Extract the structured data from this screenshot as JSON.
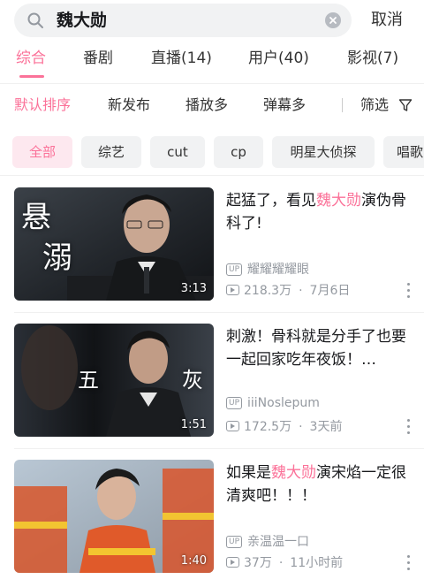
{
  "search": {
    "query": "魏大勋",
    "cancel_label": "取消"
  },
  "tabs": [
    {
      "label": "综合",
      "active": true
    },
    {
      "label": "番剧"
    },
    {
      "label": "直播(14)"
    },
    {
      "label": "用户(40)"
    },
    {
      "label": "影视(7)"
    }
  ],
  "sort": {
    "options": [
      "默认排序",
      "新发布",
      "播放多",
      "弹幕多"
    ],
    "active": "默认排序",
    "filter_label": "筛选"
  },
  "chips": [
    "全部",
    "综艺",
    "cut",
    "cp",
    "明星大侦探",
    "唱歌"
  ],
  "videos": [
    {
      "title_before": "起猛了，看见",
      "title_highlight": "魏大勋",
      "title_after": "演伪骨科了!",
      "thumb_text": [
        "悬",
        "溺"
      ],
      "duration": "3:13",
      "uploader": "耀耀耀耀眼",
      "views": "218.3万",
      "date": "7月6日"
    },
    {
      "title_before": "刺激！骨科就是分手了也要一起回家吃年夜饭！…",
      "title_highlight": "",
      "title_after": "",
      "thumb_text": [
        "五",
        "灰"
      ],
      "duration": "1:51",
      "uploader": "iiiNoslepum",
      "views": "172.5万",
      "date": "3天前"
    },
    {
      "title_before": "如果是",
      "title_highlight": "魏大勋",
      "title_after": "演宋焰一定很清爽吧！！！",
      "thumb_text": [],
      "duration": "1:40",
      "uploader": "亲温温一口",
      "views": "37万",
      "date": "11小时前"
    }
  ],
  "colors": {
    "accent": "#fb7299",
    "meta": "#9499a0",
    "chip_bg": "#f1f2f3"
  },
  "icons": [
    "search-icon",
    "clear-icon",
    "filter-icon",
    "up-badge-icon",
    "play-count-icon",
    "more-icon"
  ]
}
